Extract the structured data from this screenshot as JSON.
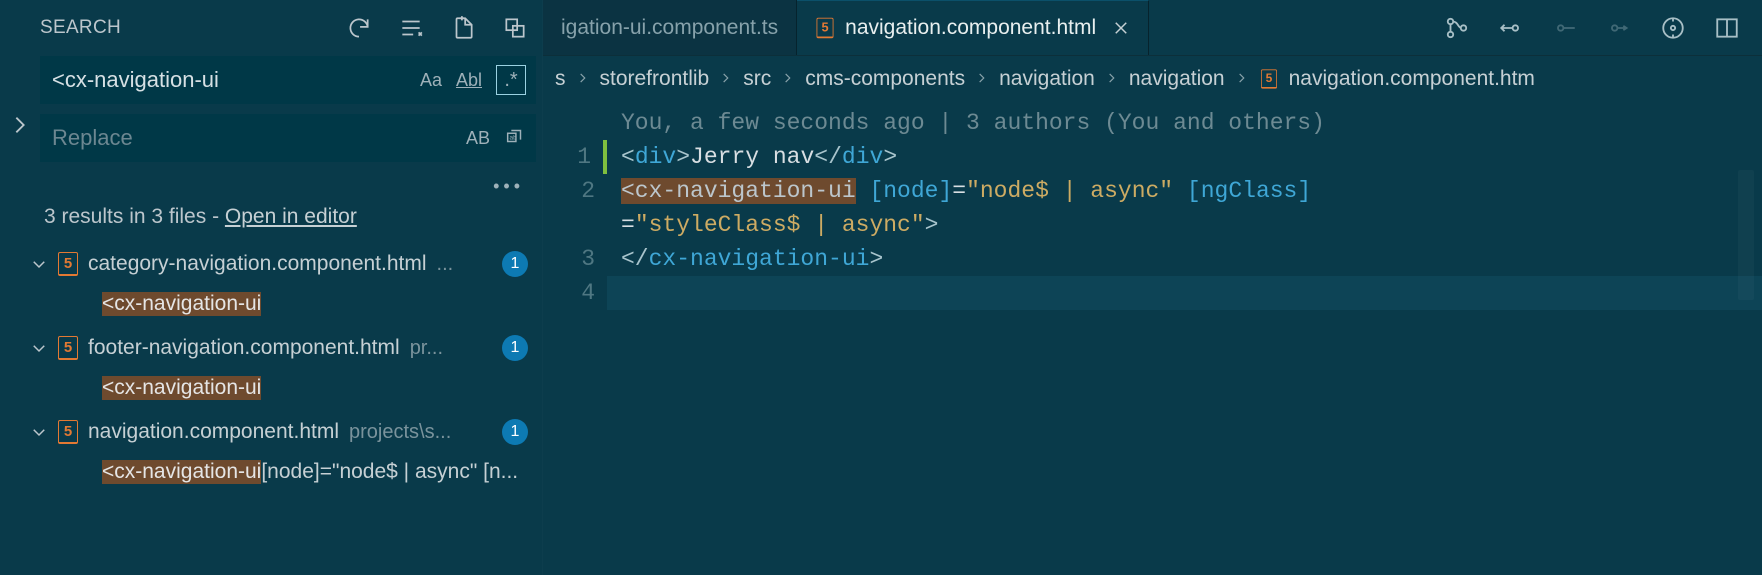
{
  "panel": {
    "title": "SEARCH",
    "search_value": "<cx-navigation-ui",
    "replace_placeholder": "Replace",
    "match_case": "Aa",
    "whole_word": "Abl",
    "regex": ".*",
    "preserve_case": "AB",
    "summary_prefix": "3 results in 3 files - ",
    "summary_link": "Open in editor"
  },
  "results": [
    {
      "file": "category-navigation.component.html",
      "path": "...",
      "badge": "1",
      "match_pre": "",
      "match_hl": "<cx-navigation-ui",
      "match_post": ""
    },
    {
      "file": "footer-navigation.component.html",
      "path": "pr...",
      "badge": "1",
      "match_pre": "",
      "match_hl": "<cx-navigation-ui",
      "match_post": ""
    },
    {
      "file": "navigation.component.html",
      "path": "projects\\s...",
      "badge": "1",
      "match_pre": "",
      "match_hl": "<cx-navigation-ui",
      "match_post": " [node]=\"node$ | async\" [n..."
    }
  ],
  "tabs": {
    "left": "igation-ui.component.ts",
    "active": "navigation.component.html"
  },
  "breadcrumbs": {
    "c1": "s",
    "c2": "storefrontlib",
    "c3": "src",
    "c4": "cms-components",
    "c5": "navigation",
    "c6": "navigation",
    "c7": "navigation.component.htm"
  },
  "code": {
    "annotation": "You, a few seconds ago | 3 authors (You and others)",
    "l1": {
      "n": "1",
      "open_pun": "<",
      "tag": "div",
      "close_pun": ">",
      "text": "Jerry nav",
      "end_open": "</",
      "end_tag": "div",
      "end_close": ">"
    },
    "l2": {
      "n": "2",
      "hl": "<cx-navigation-ui",
      "attr1": " [node]",
      "eq1": "=",
      "str1": "\"node$ | async\"",
      "attr2": " [ngClass]",
      "wrap_eq": "=",
      "wrap_str": "\"styleClass$ | async\"",
      "wrap_close": ">"
    },
    "l3": {
      "n": "3",
      "open": "</",
      "tag": "cx-navigation-ui",
      "close": ">"
    },
    "l4": {
      "n": "4"
    }
  }
}
